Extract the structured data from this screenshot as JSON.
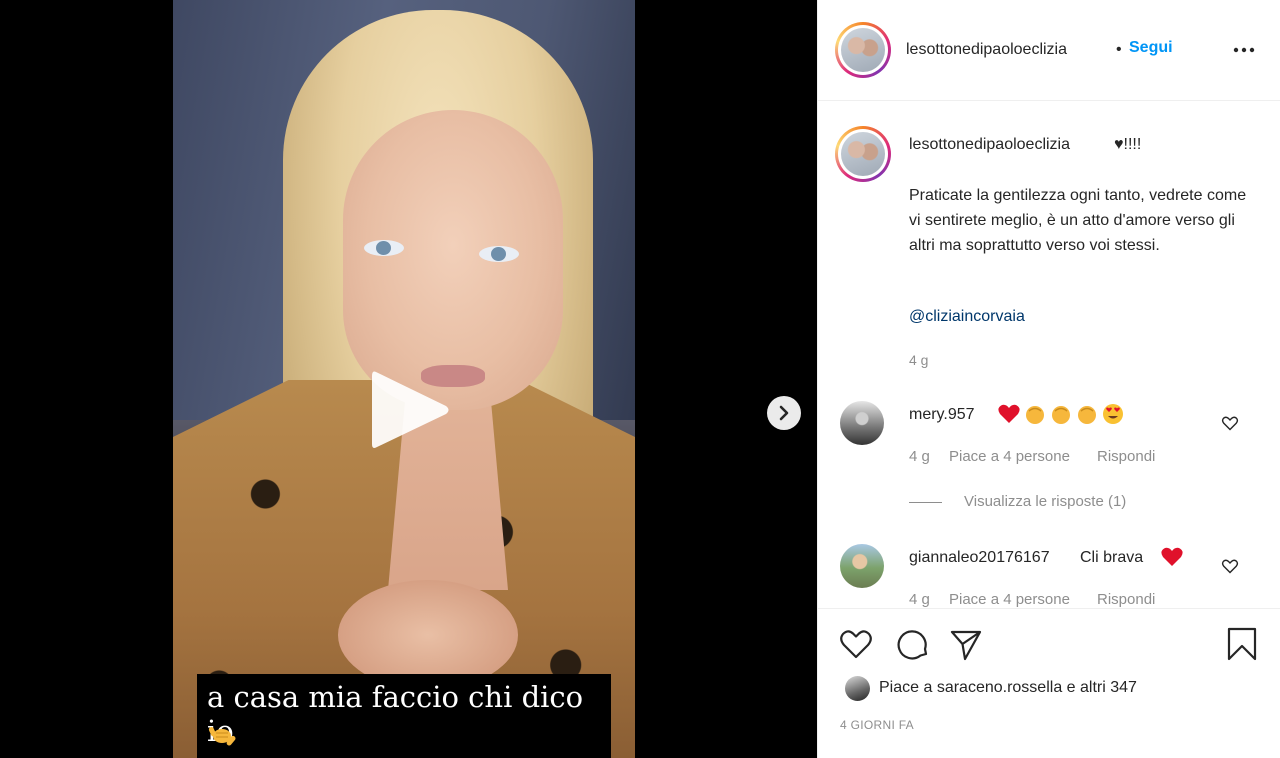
{
  "video": {
    "subtitle": "a casa mia faccio chi dico io",
    "subtitle_emoji": "call-me-hand-emoji"
  },
  "header": {
    "username": "lesottonedipaoloeclizia",
    "separator": "•",
    "follow_label": "Segui"
  },
  "caption": {
    "username": "lesottonedipaoloeclizia",
    "title": "♥!!!!",
    "text": "Praticate la gentilezza ogni tanto, vedrete come vi sentirete meglio, è un atto d'amore verso gli altri ma soprattutto verso voi stessi.",
    "mention": "@cliziaincorvaia",
    "time": "4 g"
  },
  "comments": [
    {
      "username": "mery.957",
      "text": "",
      "emojis": [
        "red-heart",
        "clapping-hands",
        "clapping-hands",
        "clapping-hands",
        "heart-eyes-face"
      ],
      "time": "4 g",
      "likes": "Piace a 4 persone",
      "reply_label": "Rispondi",
      "view_replies": "Visualizza le risposte (1)"
    },
    {
      "username": "giannaleo20176167",
      "text": "Cli brava",
      "emojis": [
        "red-heart"
      ],
      "time": "4 g",
      "likes": "Piace a 4 persone",
      "reply_label": "Rispondi"
    }
  ],
  "likes": {
    "prefix": "Piace a ",
    "user": "saraceno.rossella",
    "middle": " e ",
    "others": "altri 347"
  },
  "post_date": "4 GIORNI FA",
  "colors": {
    "accent_blue": "#0095f6",
    "mention_blue": "#00376b",
    "muted_gray": "#8e8e8e",
    "heart_red": "#ed4956"
  }
}
